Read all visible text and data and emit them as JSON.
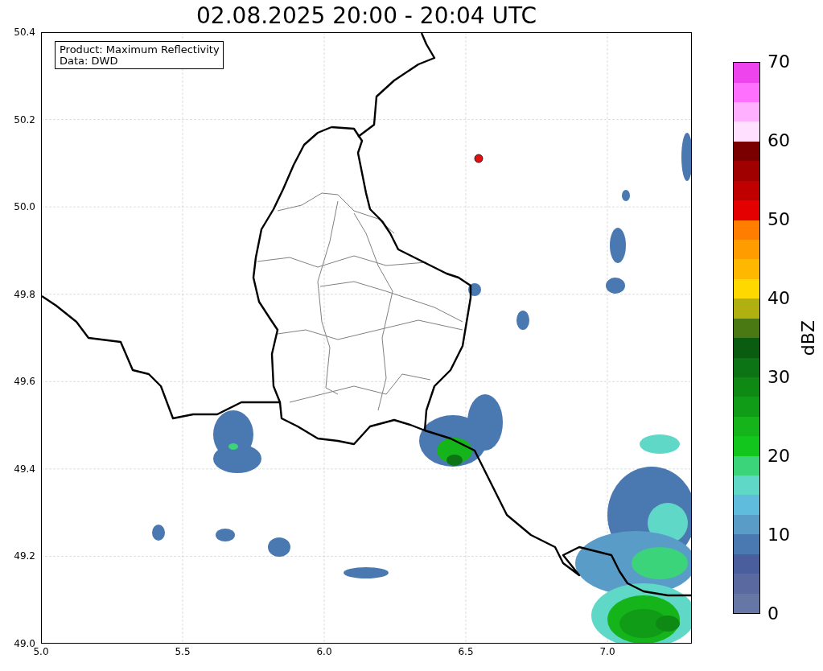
{
  "title": "02.08.2025 20:00 - 20:04 UTC",
  "info_box": {
    "lines": [
      "Product: Maximum Reflectivity",
      "Data: DWD"
    ]
  },
  "map": {
    "xticks": [
      "5.0",
      "5.5",
      "6.0",
      "6.5",
      "7.0"
    ],
    "yticks": [
      "50.4",
      "50.2",
      "50.0",
      "49.8",
      "49.6",
      "49.4",
      "49.2",
      "49.0"
    ]
  },
  "colorbar": {
    "label": "dBZ",
    "ticks": [
      "70",
      "60",
      "50",
      "40",
      "30",
      "20",
      "10",
      "0"
    ],
    "bins": [
      {
        "color": "#6677a6"
      },
      {
        "color": "#5a6aa0"
      },
      {
        "color": "#4a5e9e"
      },
      {
        "color": "#4a78b0"
      },
      {
        "color": "#5a9cc8"
      },
      {
        "color": "#60bcdc"
      },
      {
        "color": "#60d8c8"
      },
      {
        "color": "#3cd47a"
      },
      {
        "color": "#12c61e"
      },
      {
        "color": "#14b41a"
      },
      {
        "color": "#109c16"
      },
      {
        "color": "#0e8a14"
      },
      {
        "color": "#0c7414"
      },
      {
        "color": "#0a5c10"
      },
      {
        "color": "#4a7812"
      },
      {
        "color": "#b0b010"
      },
      {
        "color": "#ffd800"
      },
      {
        "color": "#ffb800"
      },
      {
        "color": "#ff9c00"
      },
      {
        "color": "#ff7e00"
      },
      {
        "color": "#e40000"
      },
      {
        "color": "#c00000"
      },
      {
        "color": "#a00000"
      },
      {
        "color": "#7a0000"
      },
      {
        "color": "#ffe0ff"
      },
      {
        "color": "#ffb0ff"
      },
      {
        "color": "#ff70ff"
      },
      {
        "color": "#ee44ee"
      }
    ]
  }
}
